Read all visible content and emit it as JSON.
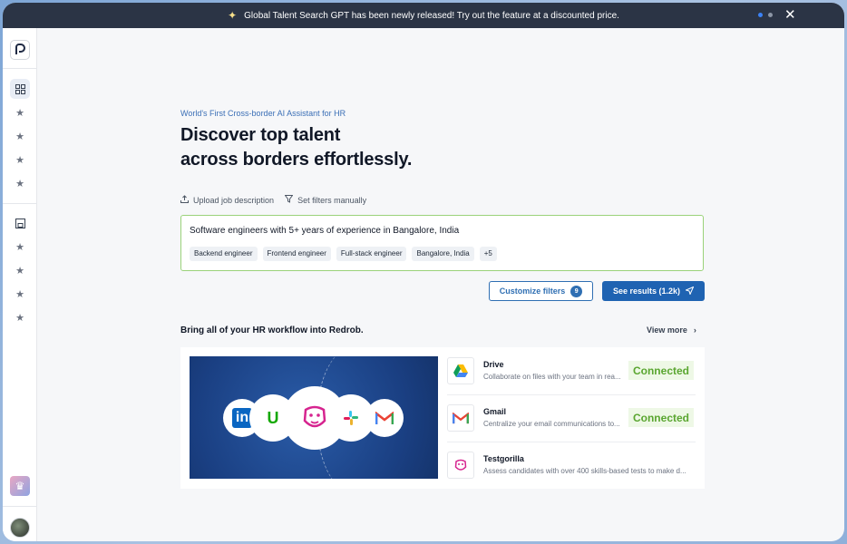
{
  "banner": {
    "text": "Global Talent Search GPT has been newly released! Try out the feature at a discounted price."
  },
  "sidebar": {
    "items": [
      "grid-icon",
      "star-icon",
      "star-icon",
      "star-icon",
      "star-icon",
      "save-icon",
      "star-icon",
      "star-icon",
      "star-icon",
      "star-icon"
    ]
  },
  "hero": {
    "eyebrow": "World's First Cross-border AI Assistant for HR",
    "line1": "Discover top talent",
    "line2": "across borders effortlessly."
  },
  "actions": {
    "upload": "Upload job description",
    "filters": "Set filters manually"
  },
  "search": {
    "query": "Software engineers with 5+ years of experience in Bangalore, India",
    "chips": [
      "Backend engineer",
      "Frontend engineer",
      "Full-stack engineer",
      "Bangalore, India",
      "+5"
    ]
  },
  "buttons": {
    "customize": "Customize filters",
    "customize_count": "9",
    "results": "See results (1.2k)"
  },
  "workflow": {
    "title": "Bring all of your HR workflow into Redrob.",
    "view_more": "View more",
    "apps": [
      {
        "name": "Drive",
        "desc": "Collaborate on files with your team in rea...",
        "status": "Connected"
      },
      {
        "name": "Gmail",
        "desc": "Centralize your email communications to...",
        "status": "Connected"
      },
      {
        "name": "Testgorilla",
        "desc": "Assess candidates with over 400 skills-based tests to make d...",
        "status": ""
      }
    ]
  },
  "colors": {
    "primary": "#1f63b2",
    "banner_bg": "#2b3445",
    "connected": "#5aa630",
    "search_border": "#9ad27a"
  }
}
